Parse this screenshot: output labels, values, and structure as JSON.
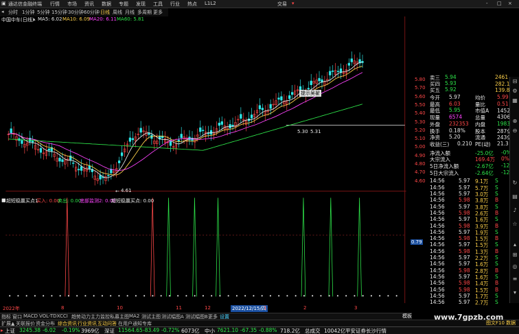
{
  "titlebar": {
    "app_name": "通达信金融终端",
    "menu": [
      "行情",
      "市场",
      "资讯",
      "数据",
      "专题",
      "发现",
      "工具",
      "行业",
      "热点",
      "L1L2"
    ],
    "trade_label": "交易",
    "window_buttons": [
      "-",
      "□",
      "×"
    ]
  },
  "periodbar": {
    "items": [
      "分时",
      "1分钟",
      "5分钟",
      "15分钟",
      "30分钟",
      "60分钟",
      "日线",
      "周线",
      "月线",
      "多周期",
      "更多"
    ],
    "active_index": 6
  },
  "chart": {
    "stock_label": "中国中车(日线)",
    "ma_legend": [
      {
        "label": "MA5: 6.02",
        "color": "#e8e8e8"
      },
      {
        "label": "MA10: 6.09",
        "color": "#ffd24a"
      },
      {
        "label": "MA20: 6.11",
        "color": "#ff44ff"
      },
      {
        "label": "MA60: 5.81",
        "color": "#2ee64a"
      }
    ],
    "price_axis": [
      "5.80",
      "5.70",
      "5.60",
      "5.50",
      "5.40",
      "5.30",
      "5.20",
      "5.10",
      "5.00",
      "4.90",
      "4.80",
      "4.70",
      "4.60"
    ],
    "low_marker": "4.61",
    "crosshair_labels": [
      "5.30",
      "5.31"
    ],
    "tooltip_label": "提示吴翟",
    "indicator_legend": [
      {
        "label": "超短稳赢买点1",
        "color": "#e8e8e8"
      },
      {
        "label": "买入: 0.00",
        "color": "#ff4848"
      },
      {
        "label": "卖出: 0.00",
        "color": "#2ee64a"
      },
      {
        "label": "底部监测2: 0.00",
        "color": "#ff44ff"
      },
      {
        "label": "超短稳赢买点: 0.00",
        "color": "#e8e8e8"
      }
    ],
    "indicator_value": "0.79",
    "date_axis": [
      "2022年",
      "8",
      "10",
      "11",
      "12",
      "2022/12/15/四",
      "1",
      "2",
      "3"
    ]
  },
  "quote_panel": {
    "asks": [
      {
        "label": "卖三",
        "price": "5.94",
        "vol": "2461"
      },
      {
        "label": "买四",
        "price": "5.93",
        "vol": "282.1万"
      },
      {
        "label": "买五",
        "price": "5.92",
        "vol": "139.8万"
      }
    ],
    "rows": [
      {
        "l1": "今开",
        "v1": "5.97",
        "l2": "均价",
        "v2": "5.99",
        "c1": "white",
        "c2": "red"
      },
      {
        "l1": "最高",
        "v1": "6.03",
        "l2": "量比",
        "v2": "0.51",
        "c1": "red",
        "c2": "red"
      },
      {
        "l1": "最低",
        "v1": "5.95",
        "l2": "市值A",
        "v2": "1452亿",
        "c1": "green",
        "c2": "white"
      },
      {
        "l1": "现量",
        "v1": "6574",
        "l2": "总量",
        "v2": "430692",
        "c1": "mag",
        "c2": "white"
      },
      {
        "l1": "外盘",
        "v1": "232353",
        "l2": "内盘",
        "v2": "198339",
        "c1": "red",
        "c2": "green"
      },
      {
        "l1": "换手",
        "v1": "0.18%",
        "l2": "股本",
        "v2": "287亿",
        "c1": "white",
        "c2": "white"
      },
      {
        "l1": "净资",
        "v1": "5.20",
        "l2": "流通",
        "v2": "243亿",
        "c1": "white",
        "c2": "white"
      },
      {
        "l1": "收益(三)",
        "v1": "0.210",
        "l2": "PE(动)",
        "v2": "21.3",
        "c1": "white",
        "c2": "white"
      }
    ],
    "flows": [
      {
        "label": "净流入额",
        "value": "-25.0亿",
        "pct": "-0%",
        "color": "green"
      },
      {
        "label": "大宗流入",
        "value": "169.4万",
        "pct": "0%",
        "color": "red"
      },
      {
        "label": "5日净流入额",
        "value": "-2.67亿",
        "pct": "-12%",
        "color": "green"
      },
      {
        "label": "5日大宗流入",
        "value": "-2.64亿",
        "pct": "-12%",
        "color": "green"
      }
    ],
    "ticks": [
      {
        "time": "14:56",
        "price": "5.97",
        "vol": "9.1万",
        "side": "S"
      },
      {
        "time": "14:56",
        "price": "5.97",
        "vol": "5.7万",
        "side": "S"
      },
      {
        "time": "14:56",
        "price": "5.97",
        "vol": "3.0万",
        "side": "S"
      },
      {
        "time": "14:56",
        "price": "5.98",
        "vol": "3.8万",
        "side": "B"
      },
      {
        "time": "14:56",
        "price": "5.97",
        "vol": "3.8万",
        "side": "S"
      },
      {
        "time": "14:56",
        "price": "5.98",
        "vol": "2.6万",
        "side": "B"
      },
      {
        "time": "14:56",
        "price": "5.97",
        "vol": "1.6万",
        "side": "S"
      },
      {
        "time": "14:56",
        "price": "5.98",
        "vol": "3.9万",
        "side": "B"
      },
      {
        "time": "14:56",
        "price": "5.97",
        "vol": "1.9万",
        "side": "S"
      },
      {
        "time": "14:56",
        "price": "5.98",
        "vol": "1.5万",
        "side": "B"
      },
      {
        "time": "14:56",
        "price": "5.97",
        "vol": "1.5万",
        "side": "S"
      },
      {
        "time": "14:56",
        "price": "5.98",
        "vol": "1.3万",
        "side": "B"
      },
      {
        "time": "14:56",
        "price": "5.97",
        "vol": "2.2万",
        "side": "S"
      },
      {
        "time": "14:56",
        "price": "5.97",
        "vol": "1.6万",
        "side": "S"
      },
      {
        "time": "14:56",
        "price": "5.98",
        "vol": "2.8万",
        "side": "B"
      },
      {
        "time": "14:56",
        "price": "5.97",
        "vol": "1.6万",
        "side": "S"
      },
      {
        "time": "14:56",
        "price": "5.98",
        "vol": "1.4万",
        "side": "B"
      },
      {
        "time": "14:56",
        "price": "5.98",
        "vol": "1.5万",
        "side": "B"
      },
      {
        "time": "14:56",
        "price": "5.97",
        "vol": "1.7万",
        "side": "S"
      },
      {
        "time": "14:56",
        "price": "5.97",
        "vol": "2.7万",
        "side": "S"
      }
    ]
  },
  "tabs_row1": [
    "指标",
    "窗口",
    "MACD",
    "VOL-TDX",
    "CCI",
    "趋势动力",
    "主力监控",
    "私募主图",
    "MA2",
    "测试主图",
    "测试幅图A",
    "测试幅图B",
    "更多",
    "设置"
  ],
  "tabs_row1_right": "模板",
  "tabs_row2": [
    "扩展▲",
    "关联报价",
    "资金分布",
    "综合资讯",
    "行业资讯",
    "互动问答",
    "在用户通知专库"
  ],
  "tabs_row2_right": "图文F10 数据",
  "status": [
    {
      "label": "上证",
      "value": "3245.38",
      "change": "-6.02",
      "pct": "-0.19%",
      "amount": "3969亿"
    },
    {
      "label": "深证",
      "value": "11564.65",
      "change": "-83.49",
      "pct": "-0.72%",
      "amount": "6073亿"
    },
    {
      "label": "中小",
      "value": "7621.10",
      "change": "-67.35",
      "pct": "-0.88%",
      "amount": "718.2亿"
    }
  ],
  "status_right": "总成交",
  "status_right_value": "10042亿",
  "status_marquee": "平安证券长沙行情",
  "watermark": "www.7gpzb.com"
}
